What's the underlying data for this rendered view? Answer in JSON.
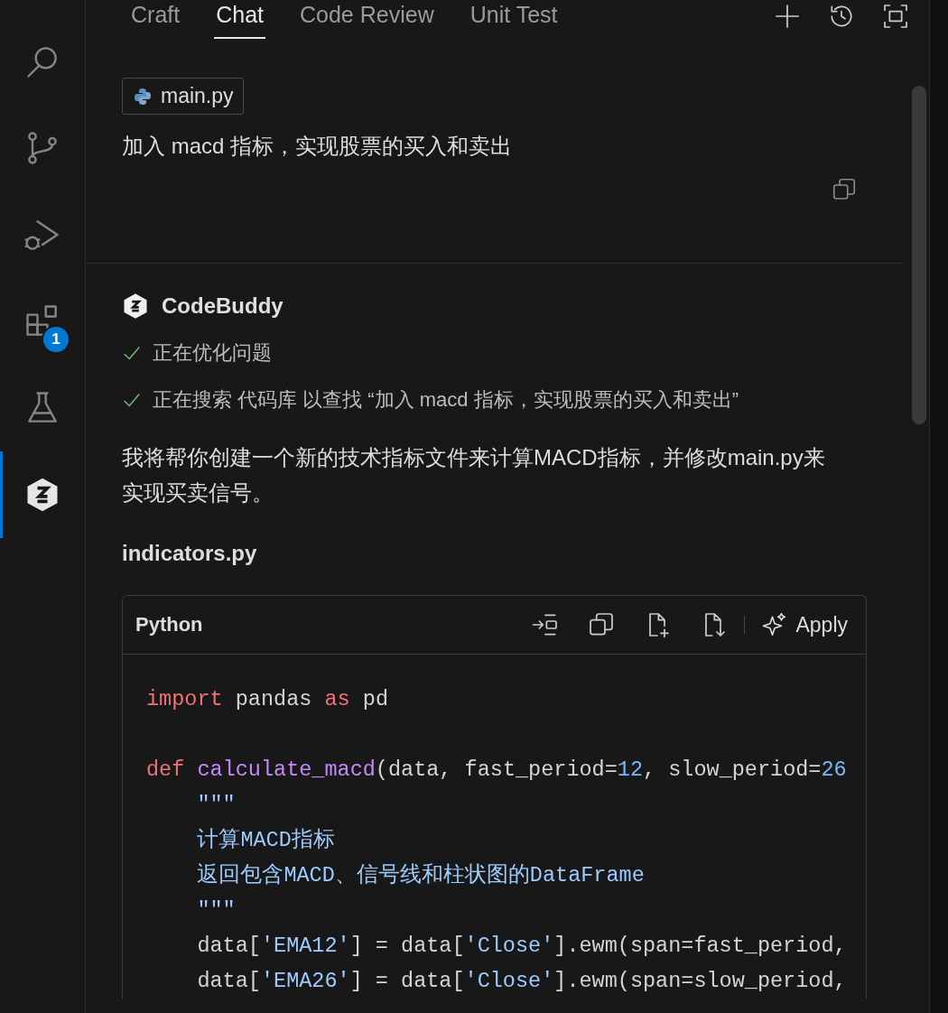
{
  "activity_bar": {
    "items": [
      {
        "kind": "search",
        "selected": false
      },
      {
        "kind": "source-control",
        "selected": false
      },
      {
        "kind": "run-debug",
        "selected": false
      },
      {
        "kind": "extensions",
        "selected": false,
        "badge": "1"
      },
      {
        "kind": "testing",
        "selected": false
      },
      {
        "kind": "codebuddy",
        "selected": true
      }
    ]
  },
  "tabs": [
    {
      "label": "Craft",
      "selected": false
    },
    {
      "label": "Chat",
      "selected": true
    },
    {
      "label": "Code Review",
      "selected": false
    },
    {
      "label": "Unit Test",
      "selected": false
    }
  ],
  "user_message": {
    "attachment": "main.py",
    "text": "加入 macd 指标，实现股票的买入和卖出"
  },
  "assistant": {
    "name": "CodeBuddy",
    "steps": [
      {
        "text": "正在优化问题",
        "done": true
      },
      {
        "text": "正在搜索 代码库 以查找 “加入 macd 指标，实现股票的买入和卖出”",
        "done": true
      }
    ],
    "reply": "我将帮你创建一个新的技术指标文件来计算MACD指标，并修改main.py来实现买卖信号。",
    "file_title": "indicators.py",
    "code_block": {
      "language": "Python",
      "apply_label": "Apply",
      "lines": [
        {
          "kind": "code",
          "tokens": [
            {
              "kind": "keyword",
              "text": "import"
            },
            {
              "kind": "plain",
              "text": " pandas "
            },
            {
              "kind": "keyword",
              "text": "as"
            },
            {
              "kind": "plain",
              "text": " pd"
            }
          ]
        },
        {
          "kind": "blank"
        },
        {
          "kind": "code",
          "tokens": [
            {
              "kind": "keyword",
              "text": "def "
            },
            {
              "kind": "function",
              "text": "calculate_macd"
            },
            {
              "kind": "plain",
              "text": "(data, fast_period="
            },
            {
              "kind": "number",
              "text": "12"
            },
            {
              "kind": "plain",
              "text": ", slow_period="
            },
            {
              "kind": "number",
              "text": "26"
            }
          ]
        },
        {
          "kind": "code",
          "tokens": [
            {
              "kind": "doc",
              "text": "    \"\"\""
            }
          ]
        },
        {
          "kind": "code",
          "tokens": [
            {
              "kind": "doc",
              "text": "    计算MACD指标"
            }
          ]
        },
        {
          "kind": "code",
          "tokens": [
            {
              "kind": "doc",
              "text": "    返回包含MACD、信号线和柱状图的DataFrame"
            }
          ]
        },
        {
          "kind": "code",
          "tokens": [
            {
              "kind": "doc",
              "text": "    \"\"\""
            }
          ]
        },
        {
          "kind": "code",
          "tokens": [
            {
              "kind": "plain",
              "text": "    data["
            },
            {
              "kind": "string",
              "text": "'EMA12'"
            },
            {
              "kind": "plain",
              "text": "] = data["
            },
            {
              "kind": "string",
              "text": "'Close'"
            },
            {
              "kind": "plain",
              "text": "].ewm(span=fast_period,"
            }
          ]
        },
        {
          "kind": "code",
          "tokens": [
            {
              "kind": "plain",
              "text": "    data["
            },
            {
              "kind": "string",
              "text": "'EMA26'"
            },
            {
              "kind": "plain",
              "text": "] = data["
            },
            {
              "kind": "string",
              "text": "'Close'"
            },
            {
              "kind": "plain",
              "text": "].ewm(span=slow_period,"
            }
          ]
        }
      ]
    }
  }
}
